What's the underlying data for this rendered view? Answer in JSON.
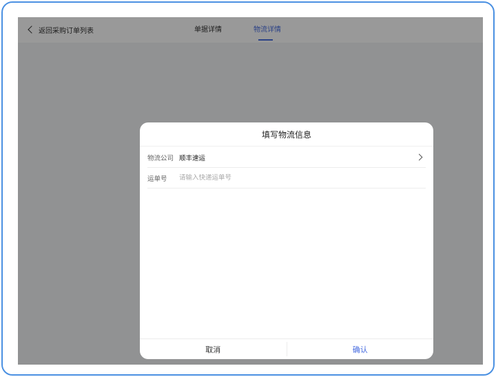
{
  "nav": {
    "back_label": "返回采购订单列表",
    "tabs": [
      {
        "label": "单据详情"
      },
      {
        "label": "物流详情"
      }
    ]
  },
  "dialog": {
    "title": "填写物流信息",
    "company_label": "物流公司",
    "company_value": "顺丰速运",
    "tracking_label": "运单号",
    "tracking_placeholder": "请输入快递运单号",
    "tracking_value": "",
    "cancel_label": "取消",
    "confirm_label": "确认"
  },
  "colors": {
    "accent": "#4a6ee0",
    "frame": "#4a90e2",
    "overlay": "rgba(0,0,0,0.4)"
  }
}
